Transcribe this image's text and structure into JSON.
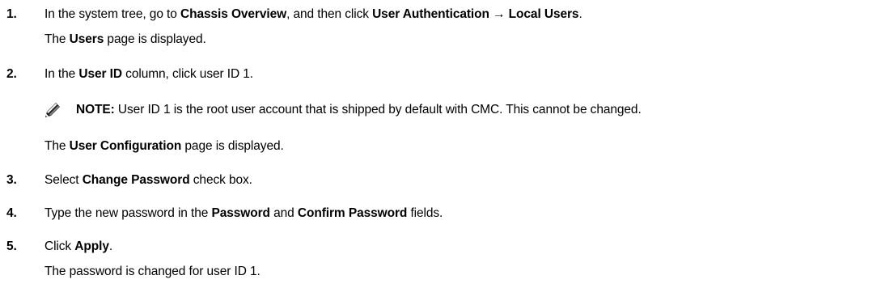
{
  "steps": [
    {
      "number": "1.",
      "text": {
        "a": "In the system tree, go to ",
        "b": "Chassis Overview",
        "c": ", and then click ",
        "d": "User Authentication → Local Users",
        "e": "."
      },
      "result": {
        "a": "The ",
        "b": "Users",
        "c": " page is displayed."
      }
    },
    {
      "number": "2.",
      "text": {
        "a": "In the ",
        "b": "User ID",
        "c": " column, click user ID 1."
      },
      "note": {
        "label": "NOTE:",
        "body": " User ID 1 is the root user account that is shipped by default with CMC. This cannot be changed."
      },
      "result": {
        "a": "The ",
        "b": "User Configuration",
        "c": " page is displayed."
      }
    },
    {
      "number": "3.",
      "text": {
        "a": "Select ",
        "b": "Change Password",
        "c": " check box."
      }
    },
    {
      "number": "4.",
      "text": {
        "a": "Type the new password in the ",
        "b": "Password",
        "c": " and ",
        "d": "Confirm Password",
        "e": " fields."
      }
    },
    {
      "number": "5.",
      "text": {
        "a": "Click ",
        "b": "Apply",
        "c": "."
      },
      "result": {
        "plain": "The password is changed for user ID 1."
      }
    }
  ],
  "icons": {
    "note": "pencil-note-icon"
  }
}
